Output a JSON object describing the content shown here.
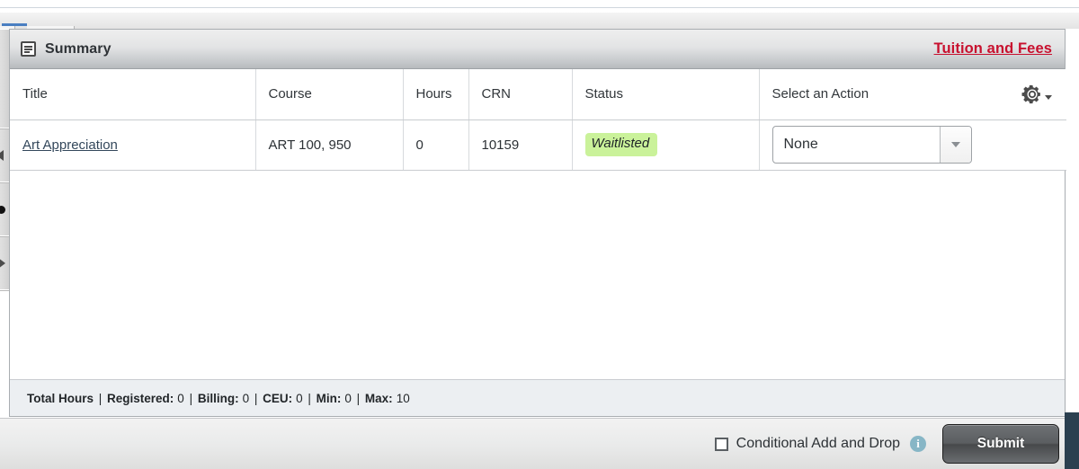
{
  "topbar": {
    "dot_button": "•",
    "caret_button": "▼"
  },
  "left_rail": {
    "collapse_left": "◀",
    "marker": "●",
    "collapse_right": "▶"
  },
  "panel": {
    "icon": "summary-table-icon",
    "title": "Summary",
    "tuition_link": "Tuition and Fees",
    "gear_icon": "gear-icon"
  },
  "table": {
    "columns": [
      "Title",
      "Course",
      "Hours",
      "CRN",
      "Status",
      "Select an Action"
    ],
    "rows": [
      {
        "title": "Art Appreciation",
        "course": "ART 100, 950",
        "hours": "0",
        "crn": "10159",
        "status": "Waitlisted",
        "status_color": "#caf29a",
        "action": "None"
      }
    ]
  },
  "totals": {
    "label": "Total Hours",
    "items": [
      {
        "label": "Registered:",
        "value": "0"
      },
      {
        "label": "Billing:",
        "value": "0"
      },
      {
        "label": "CEU:",
        "value": "0"
      },
      {
        "label": "Min:",
        "value": "0"
      },
      {
        "label": "Max:",
        "value": "10"
      }
    ]
  },
  "bottom_bar": {
    "conditional_label": "Conditional Add and Drop",
    "conditional_checked": false,
    "info_icon": "i",
    "submit_label": "Submit"
  },
  "colors": {
    "link_red": "#c8102e",
    "link_blue": "#33475b",
    "status_green": "#caf29a",
    "info_blue": "#87b6c6",
    "corner_navy": "#2b4050"
  }
}
